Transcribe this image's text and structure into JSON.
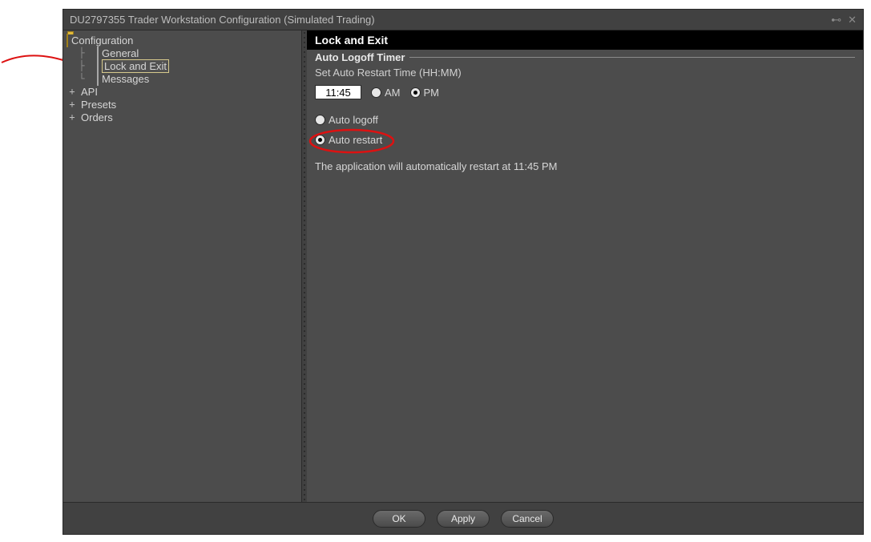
{
  "window": {
    "title": "DU2797355 Trader Workstation Configuration (Simulated Trading)"
  },
  "tree": {
    "root": "Configuration",
    "items": [
      {
        "label": "General",
        "icon": "page",
        "depth": 1,
        "branch": true,
        "expander": ""
      },
      {
        "label": "Lock and Exit",
        "icon": "page",
        "depth": 1,
        "branch": true,
        "expander": "",
        "selected": true
      },
      {
        "label": "Messages",
        "icon": "page",
        "depth": 1,
        "branch": true,
        "expander": "",
        "last": true
      },
      {
        "label": "API",
        "icon": "api",
        "depth": 0,
        "branch": false,
        "expander": "+"
      },
      {
        "label": "Presets",
        "icon": "presets",
        "depth": 0,
        "branch": false,
        "expander": "+"
      },
      {
        "label": "Orders",
        "icon": "orders",
        "depth": 0,
        "branch": false,
        "expander": "+"
      }
    ]
  },
  "panel": {
    "heading": "Lock and Exit",
    "section_title": "Auto Logoff Timer",
    "hint": "Set Auto Restart Time (HH:MM)",
    "time": "11:45",
    "am_label": "AM",
    "pm_label": "PM",
    "ampm_selected": "PM",
    "option_logoff": "Auto logoff",
    "option_restart": "Auto restart",
    "option_selected": "restart",
    "message": "The application will automatically restart at 11:45 PM"
  },
  "buttons": {
    "ok": "OK",
    "apply": "Apply",
    "cancel": "Cancel"
  }
}
